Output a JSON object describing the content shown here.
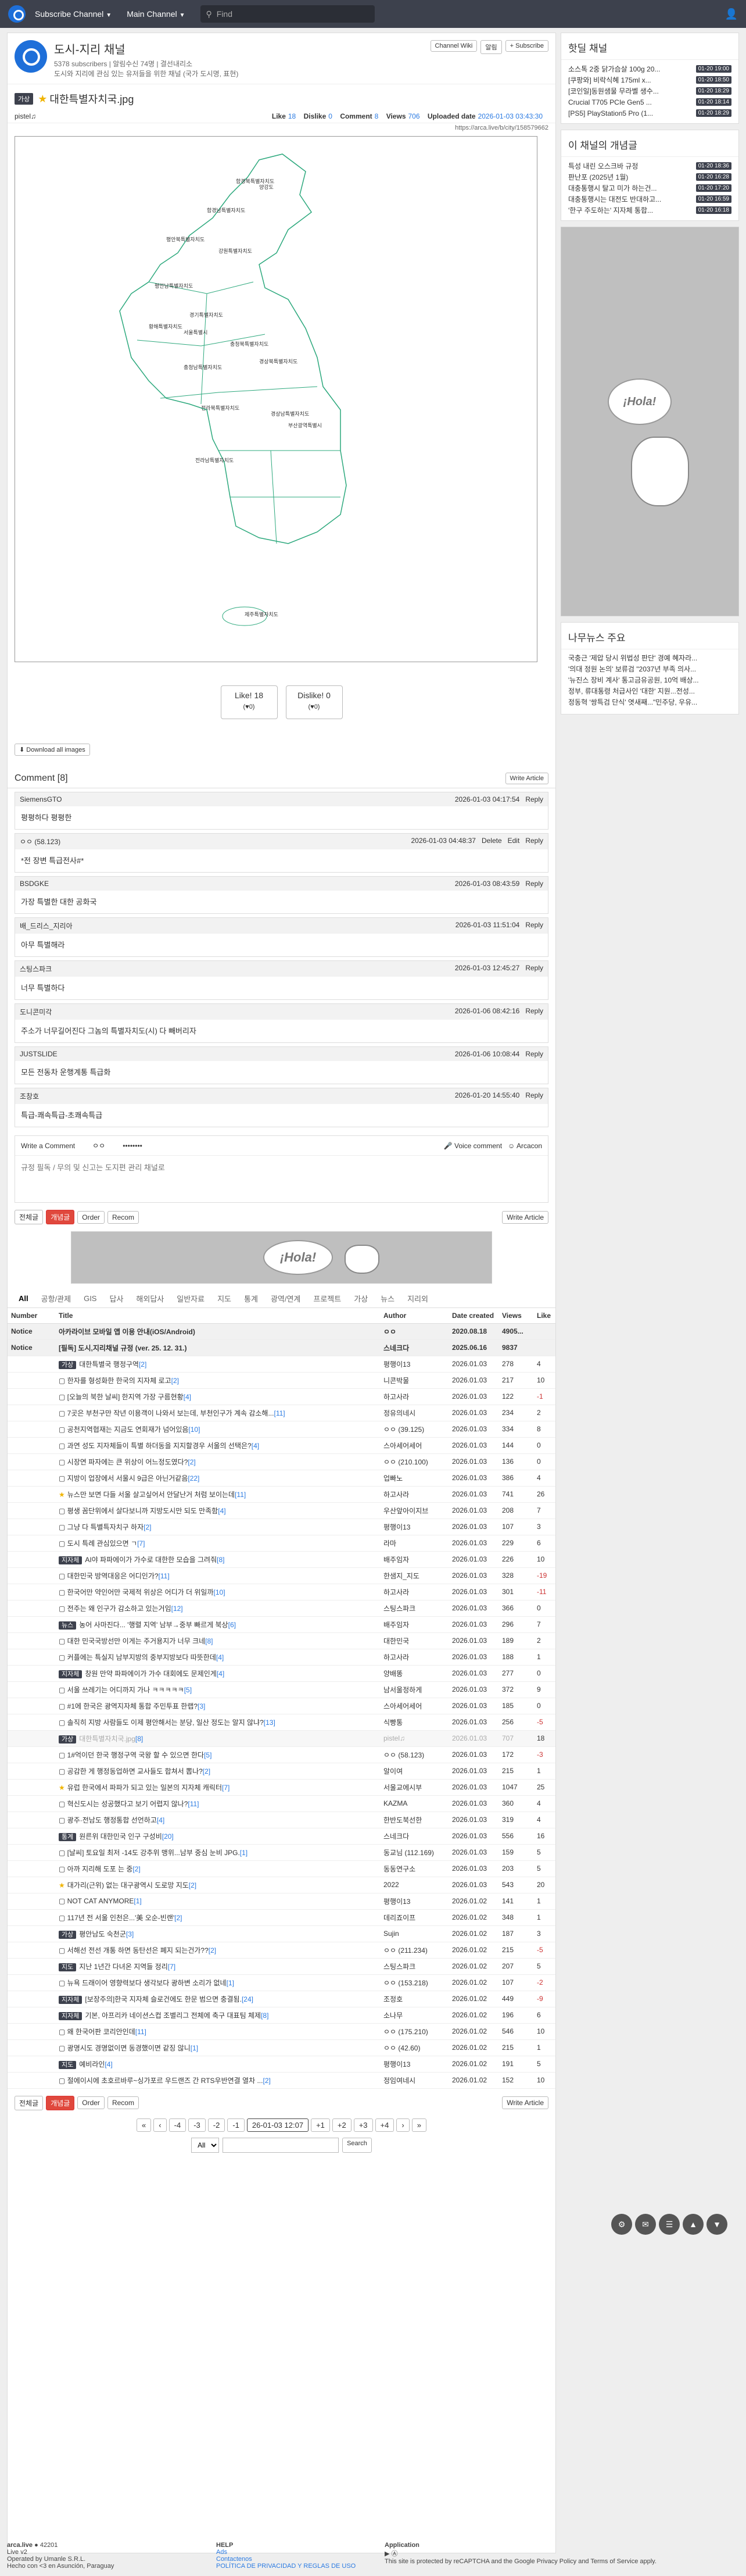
{
  "nav": {
    "subscribe": "Subscribe Channel",
    "main": "Main Channel",
    "search_placeholder": "Find"
  },
  "channel": {
    "name": "도시-지리 채널",
    "subscribers": "5378 subscribers",
    "online": "알림수신 74명",
    "owner": "결선내리소",
    "desc": "도시와 지리에 관심 있는 유저들을 위한 채널 (국가 도시명, 표현)",
    "wiki_btn": "Channel Wiki",
    "noti_btn": "알림",
    "subscribe_btn": "+ Subscribe"
  },
  "article": {
    "category": "가상",
    "title": "대한특별자치국.jpg",
    "author": "pistel♫",
    "likes_label": "Like",
    "likes": "18",
    "dislikes_label": "Dislike",
    "dislikes": "0",
    "comments_label": "Comment",
    "comments": "8",
    "views_label": "Views",
    "views": "706",
    "uploaded_label": "Uploaded date",
    "uploaded": "2026-01-03 03:43:30",
    "url": "https://arca.live/b/city/158579662"
  },
  "map_regions": [
    "함경북특별자치도",
    "함경남특별자치도",
    "양강도",
    "평안북특별자치도",
    "평안남특별자치도",
    "황해특별자치도",
    "강원특별자치도",
    "경기특별자치도",
    "서울특별시",
    "충청북특별자치도",
    "충청남특별자치도",
    "경상북특별자치도",
    "전라북특별자치도",
    "전라남특별자치도",
    "경상남특별자치도",
    "부산광역특별시",
    "제주특별자치도"
  ],
  "vote": {
    "like_label": "Like!",
    "like_count": "18",
    "like_sub": "(♥0)",
    "dislike_label": "Dislike!",
    "dislike_count": "0",
    "dislike_sub": "(♥0)"
  },
  "download": "Download all images",
  "comments_title": "Comment [8]",
  "write_article": "Write Article",
  "comment_list": [
    {
      "author": "SiemensGTO",
      "date": "2026-01-03 04:17:54",
      "reply": "Reply",
      "text": "평평하다 평평한"
    },
    {
      "author": "ㅇㅇ (58.123)",
      "date": "2026-01-03 04:48:37",
      "reply": "Reply",
      "delete": "Delete",
      "edit": "Edit",
      "text": "*전 장변 특급전사#*"
    },
    {
      "author": "BSDGKE",
      "date": "2026-01-03 08:43:59",
      "reply": "Reply",
      "text": "가장 특별한 대한 공화국"
    },
    {
      "author": "배_드리스_지리아",
      "date": "2026-01-03 11:51:04",
      "reply": "Reply",
      "text": "아무 특별해라"
    },
    {
      "author": "스팅스파크",
      "date": "2026-01-03 12:45:27",
      "reply": "Reply",
      "text": "너무 특별하다"
    },
    {
      "author": "도니콘미각",
      "date": "2026-01-06 08:42:16",
      "reply": "Reply",
      "text": "주소가 너무길어진다 그놈의 특별자치도(시) 다 빼버리자"
    },
    {
      "author": "JUSTSLIDE",
      "date": "2026-01-06 10:08:44",
      "reply": "Reply",
      "text": "모든 전동차 운행계통 특급화"
    },
    {
      "author": "조창호",
      "date": "2026-01-20 14:55:40",
      "reply": "Reply",
      "text": "특급-쾌속특급-초쾌속특급"
    }
  ],
  "write_comment": {
    "label": "Write a Comment",
    "user": "ㅇㅇ",
    "password": "••••••••",
    "voice": "Voice comment",
    "arcacon": "Arcacon",
    "placeholder": "규정 필독 / 무의 및 신고는 도지편 관리 채널로"
  },
  "toolbar": {
    "all": "전체글",
    "best": "개념글",
    "order": "Order",
    "recom": "Recom"
  },
  "ad_text": "¡Hola!",
  "tabs": [
    "All",
    "공항/관제",
    "GIS",
    "답사",
    "해외답사",
    "일반자료",
    "지도",
    "통계",
    "광역/연계",
    "프로젝트",
    "가상",
    "뉴스",
    "지리외"
  ],
  "table_headers": {
    "number": "Number",
    "title": "Title",
    "author": "Author",
    "date": "Date created",
    "views": "Views",
    "like": "Like"
  },
  "notices": [
    {
      "tag": "Notice",
      "title": "아카라이브 모바일 앱 이용 안내(iOS/Android)",
      "author": "ㅇㅇ",
      "date": "2020.08.18",
      "views": "4905...",
      "like": ""
    },
    {
      "tag": "Notice",
      "title": "[필독] 도시,지리채널 규정 (ver. 25. 12. 31.)",
      "author": "스네크다",
      "date": "2025.06.16",
      "views": "9837",
      "like": ""
    }
  ],
  "posts": [
    {
      "cat": "가상",
      "title": "대한특별국 행정구역",
      "c": "[2]",
      "author": "평행이13",
      "date": "2026.01.03",
      "views": "278",
      "like": "4"
    },
    {
      "cat": "",
      "title": "한자를 형성화한 한국의 지자체 로고",
      "c": "[2]",
      "author": "니콘박물",
      "date": "2026.01.03",
      "views": "217",
      "like": "10"
    },
    {
      "cat": "",
      "title": "[오늘의 북한 날씨] 한지역 가장 구름현황",
      "c": "[4]",
      "author": "하고사라",
      "date": "2026.01.03",
      "views": "122",
      "like": "-1"
    },
    {
      "cat": "",
      "title": "7곳은 부천구만 작년 이용객이 나와서 보는데, 부천인구가 계속 감소해...",
      "c": "[11]",
      "author": "정유의네시",
      "date": "2026.01.03",
      "views": "234",
      "like": "2"
    },
    {
      "cat": "",
      "title": "공천지역협재는 지금도 연회재가 넘어있음",
      "c": "[10]",
      "author": "ㅇㅇ (39.125)",
      "date": "2026.01.03",
      "views": "334",
      "like": "8"
    },
    {
      "cat": "",
      "title": "과연 성도 지자체들이 특별 하더동을 지지할경우 서울의 선택은?",
      "c": "[4]",
      "author": "스아세어세어",
      "date": "2026.01.03",
      "views": "144",
      "like": "0"
    },
    {
      "cat": "",
      "title": "시장연 파자에는 큰 위상이 어느정도였다?",
      "c": "[2]",
      "author": "ㅇㅇ (210.100)",
      "date": "2026.01.03",
      "views": "136",
      "like": "0"
    },
    {
      "cat": "",
      "title": "지방이 업장에서 서울시 9급은 아닌거같음",
      "c": "[22]",
      "author": "업빠노",
      "date": "2026.01.03",
      "views": "386",
      "like": "4"
    },
    {
      "cat": "★",
      "title": "뉴스만 보면 다들 서울 살고싶어서 안달난거 처럼 보이는데",
      "c": "[11]",
      "author": "하고사라",
      "date": "2026.01.03",
      "views": "741",
      "like": "26"
    },
    {
      "cat": "",
      "title": "평생 꼼단위에서 살다보니까 지방도시만 되도 만족함",
      "c": "[4]",
      "author": "우산앞아이지브",
      "date": "2026.01.03",
      "views": "208",
      "like": "7"
    },
    {
      "cat": "",
      "title": "그냥 다 특별특자치구 하자",
      "c": "[2]",
      "author": "평행이13",
      "date": "2026.01.03",
      "views": "107",
      "like": "3"
    },
    {
      "cat": "",
      "title": "도시 특례 관심있으면 ㄱ",
      "c": "[7]",
      "author": "라마",
      "date": "2026.01.03",
      "views": "229",
      "like": "6"
    },
    {
      "cat": "지자체",
      "title": "AI야 파파에이가 가수로 대한한 모습을 그려줘",
      "c": "[8]",
      "author": "배주임자",
      "date": "2026.01.03",
      "views": "226",
      "like": "10"
    },
    {
      "cat": "",
      "title": "대한민국 방역대응은 어디인가?",
      "c": "[11]",
      "author": "한샘지_지도",
      "date": "2026.01.03",
      "views": "328",
      "like": "-19"
    },
    {
      "cat": "",
      "title": "한국어만 약인어만 국제적 위상은 어디가 더 위일까",
      "c": "[10]",
      "author": "하고사라",
      "date": "2026.01.03",
      "views": "301",
      "like": "-11"
    },
    {
      "cat": "",
      "title": "전주는 왜 인구가 감소하고 있는거임",
      "c": "[12]",
      "author": "스팅스파크",
      "date": "2026.01.03",
      "views": "366",
      "like": "0"
    },
    {
      "cat": "뉴스",
      "title": "농어 사마진다... '행렬 지역' 남부→중부 빠르게 북상",
      "c": "[6]",
      "author": "배주임자",
      "date": "2026.01.03",
      "views": "296",
      "like": "7"
    },
    {
      "cat": "",
      "title": "대한 민국국방선만 이게는 주거용지가 너무 크네",
      "c": "[8]",
      "author": "대한민국",
      "date": "2026.01.03",
      "views": "189",
      "like": "2"
    },
    {
      "cat": "",
      "title": "커플에는 특실지 남부지방의 중부지방보다 따뜻한데",
      "c": "[4]",
      "author": "하고사라",
      "date": "2026.01.03",
      "views": "188",
      "like": "1"
    },
    {
      "cat": "지자체",
      "title": "창원 만약 파파에이가 가수 대회에도 문제인게",
      "c": "[4]",
      "author": "양배똥",
      "date": "2026.01.03",
      "views": "277",
      "like": "0"
    },
    {
      "cat": "",
      "title": "서울 쓰레기는 어디까지 가나 ㅋㅋㅋㅋㅋ",
      "c": "[5]",
      "author": "남서울정하게",
      "date": "2026.01.03",
      "views": "372",
      "like": "9"
    },
    {
      "cat": "",
      "title": "#1에 한국은 광역지자체 통합 주민투표 한랩?",
      "c": "[3]",
      "author": "스아세어세어",
      "date": "2026.01.03",
      "views": "185",
      "like": "0"
    },
    {
      "cat": "",
      "title": "솔직히 지방 사람들도 이제 평안해서는 분당, 일산 정도는 알지 않냐?",
      "c": "[13]",
      "author": "식빵통",
      "date": "2026.01.03",
      "views": "256",
      "like": "-5"
    },
    {
      "cat": "가상",
      "title": "대한특별자치국.jpg",
      "c": "[8]",
      "author": "pistel♫",
      "date": "2026.01.03",
      "views": "707",
      "like": "18",
      "current": true
    },
    {
      "cat": "",
      "title": "1#억이던 한국 행정구역 국왕 할 수 있으면 한다",
      "c": "[5]",
      "author": "ㅇㅇ (58.123)",
      "date": "2026.01.03",
      "views": "172",
      "like": "-3"
    },
    {
      "cat": "",
      "title": "공감한 게 행정동업하면 교사들도 합쳐서 뽑나?",
      "c": "[2]",
      "author": "알이여",
      "date": "2026.01.03",
      "views": "215",
      "like": "1"
    },
    {
      "cat": "★",
      "title": "유럽 한국에서 파파가 되고 있는 일본의 지자체 캐릭터",
      "c": "[7]",
      "author": "서울교에시부",
      "date": "2026.01.03",
      "views": "1047",
      "like": "25"
    },
    {
      "cat": "",
      "title": "혁신도시는 성공했다고 보기 어렵지 않나?",
      "c": "[11]",
      "author": "KAZMA",
      "date": "2026.01.03",
      "views": "360",
      "like": "4"
    },
    {
      "cat": "",
      "title": "광주·전남도 행정통합 선언하고",
      "c": "[4]",
      "author": "한반도북선한",
      "date": "2026.01.03",
      "views": "319",
      "like": "4"
    },
    {
      "cat": "통계",
      "title": "원른위 대한민국 인구 구성비",
      "c": "[20]",
      "author": "스네크다",
      "date": "2026.01.03",
      "views": "556",
      "like": "16"
    },
    {
      "cat": "",
      "title": "[날씨] 토요일 최저 -14도 강추위 맹위...남부 중심 눈비 JPG.",
      "c": "[1]",
      "author": "동교님 (112.169)",
      "date": "2026.01.03",
      "views": "159",
      "like": "5"
    },
    {
      "cat": "",
      "title": "아까 지리해 도포 는 중",
      "c": "[2]",
      "author": "동동연구소",
      "date": "2026.01.03",
      "views": "203",
      "like": "5"
    },
    {
      "cat": "★",
      "title": "대가리(근위) 없는 대구광역시 도로망 지도",
      "c": "[2]",
      "author": "2022",
      "date": "2026.01.03",
      "views": "543",
      "like": "20"
    },
    {
      "cat": "",
      "title": "NOT CAT ANYMORE",
      "c": "[1]",
      "author": "평행이13",
      "date": "2026.01.02",
      "views": "141",
      "like": "1"
    },
    {
      "cat": "",
      "title": "117년 전 서울 인천은...'美 오순-빈랜'",
      "c": "[2]",
      "author": "데리죠이프",
      "date": "2026.01.02",
      "views": "348",
      "like": "1"
    },
    {
      "cat": "가상",
      "title": "평안남도 숙천군",
      "c": "[3]",
      "author": "Sujin",
      "date": "2026.01.02",
      "views": "187",
      "like": "3"
    },
    {
      "cat": "",
      "title": "서해선 전선 개통 하면 동탄선은 폐지 되는건가??",
      "c": "[2]",
      "author": "ㅇㅇ (211.234)",
      "date": "2026.01.02",
      "views": "215",
      "like": "-5"
    },
    {
      "cat": "지도",
      "title": "지난 1년간 다녀온 지역들 정리",
      "c": "[7]",
      "author": "스팅스파크",
      "date": "2026.01.02",
      "views": "207",
      "like": "5"
    },
    {
      "cat": "",
      "title": "뉴욕 드래이어 영향력보다 생각보다 광하변 소리가 없네",
      "c": "[1]",
      "author": "ㅇㅇ (153.218)",
      "date": "2026.01.02",
      "views": "107",
      "like": "-2"
    },
    {
      "cat": "지자체",
      "title": "[보장주의]한국 지자체 슬로건에도 한문 범으면 충결됨.",
      "c": "[24]",
      "author": "조정호",
      "date": "2026.01.02",
      "views": "449",
      "like": "-9"
    },
    {
      "cat": "지자체",
      "title": "기본, 아프리카 네이션스컵 조별리그 전체에 축구 대표팀 체제",
      "c": "[8]",
      "author": "소나무",
      "date": "2026.01.02",
      "views": "196",
      "like": "6"
    },
    {
      "cat": "",
      "title": "왜 한국어판 코리안인데",
      "c": "[11]",
      "author": "ㅇㅇ (175.210)",
      "date": "2026.01.02",
      "views": "546",
      "like": "10"
    },
    {
      "cat": "",
      "title": "광명시도 경명없이면 동경했이면 같징 않니",
      "c": "[1]",
      "author": "ㅇㅇ (42.60)",
      "date": "2026.01.02",
      "views": "215",
      "like": "1"
    },
    {
      "cat": "지도",
      "title": "예비라인",
      "c": "[4]",
      "author": "평행이13",
      "date": "2026.01.02",
      "views": "191",
      "like": "5"
    },
    {
      "cat": "",
      "title": "절에이시에 초호르바루~싱가포르 우드랜즈 간 RTS우반연결 열차 ...",
      "c": "[2]",
      "author": "정임여네시",
      "date": "2026.01.02",
      "views": "152",
      "like": "10"
    }
  ],
  "pager": [
    "«",
    "‹",
    "-4",
    "-3",
    "-2",
    "-1",
    "26-01-03 12:07",
    "+1",
    "+2",
    "+3",
    "+4",
    "›",
    "»"
  ],
  "search_select": "All",
  "search_btn": "Search",
  "sidebar": {
    "hot_title": "핫딜 채널",
    "hot": [
      {
        "t": "소스톡 2중 닭가슴살 100g 20...",
        "d": "01-20 19:00"
      },
      {
        "t": "[쿠팡와] 비락식혜 175ml x...",
        "d": "01-20 18:50"
      },
      {
        "t": "[코인일]동원샘물 무라벨 생수...",
        "d": "01-20 18:29"
      },
      {
        "t": "Crucial T705 PCIe Gen5 ...",
        "d": "01-20 18:14"
      },
      {
        "t": "[PS5] PlayStation5 Pro (1...",
        "d": "01-20 18:29"
      }
    ],
    "best_title": "이 채널의 개념글",
    "best": [
      {
        "t": "특성 내린 오스크바 규정",
        "d": "01-20 18:36"
      },
      {
        "t": "판난포 (2025년 1월)",
        "d": "01-20 16:28"
      },
      {
        "t": "대충통행시 탈고 미가 하는건...",
        "d": "01-20 17:20"
      },
      {
        "t": "대충통행시는 대전도 반대하고...",
        "d": "01-20 16:59"
      },
      {
        "t": "'한구 주도하는' 지자체 통합...",
        "d": "01-20 16:18"
      }
    ],
    "news_title": "나무뉴스 주요",
    "news": [
      "국충근 '제압 당시 위법성 판단' 경예 혜자라...",
      "'의대 정원 논의' 보류검 \"2037년 부족 의사...",
      "'뉴진스 장비 계사' 통고금유공원, 10억 배상...",
      "정부, 류대통령 처급사인 '대한' 지원...전성...",
      "정동혁 '쌍특검 단식' 엿새째...\"민주당, 우유..."
    ]
  },
  "footer": {
    "brand": "arca.live",
    "count": "42201",
    "ver": "Live v2",
    "company": "Operated by Umanle S.R.L.",
    "city": "Hecho con <3 en Asunción, Paraguay",
    "help": "HELP",
    "help_links": [
      "Ads",
      "Contactenos",
      "POLÍTICA DE PRIVACIDAD Y REGLAS DE USO"
    ],
    "app": "Application",
    "recaptcha": "This site is protected by reCAPTCHA and the Google Privacy Policy and Terms of Service apply."
  }
}
